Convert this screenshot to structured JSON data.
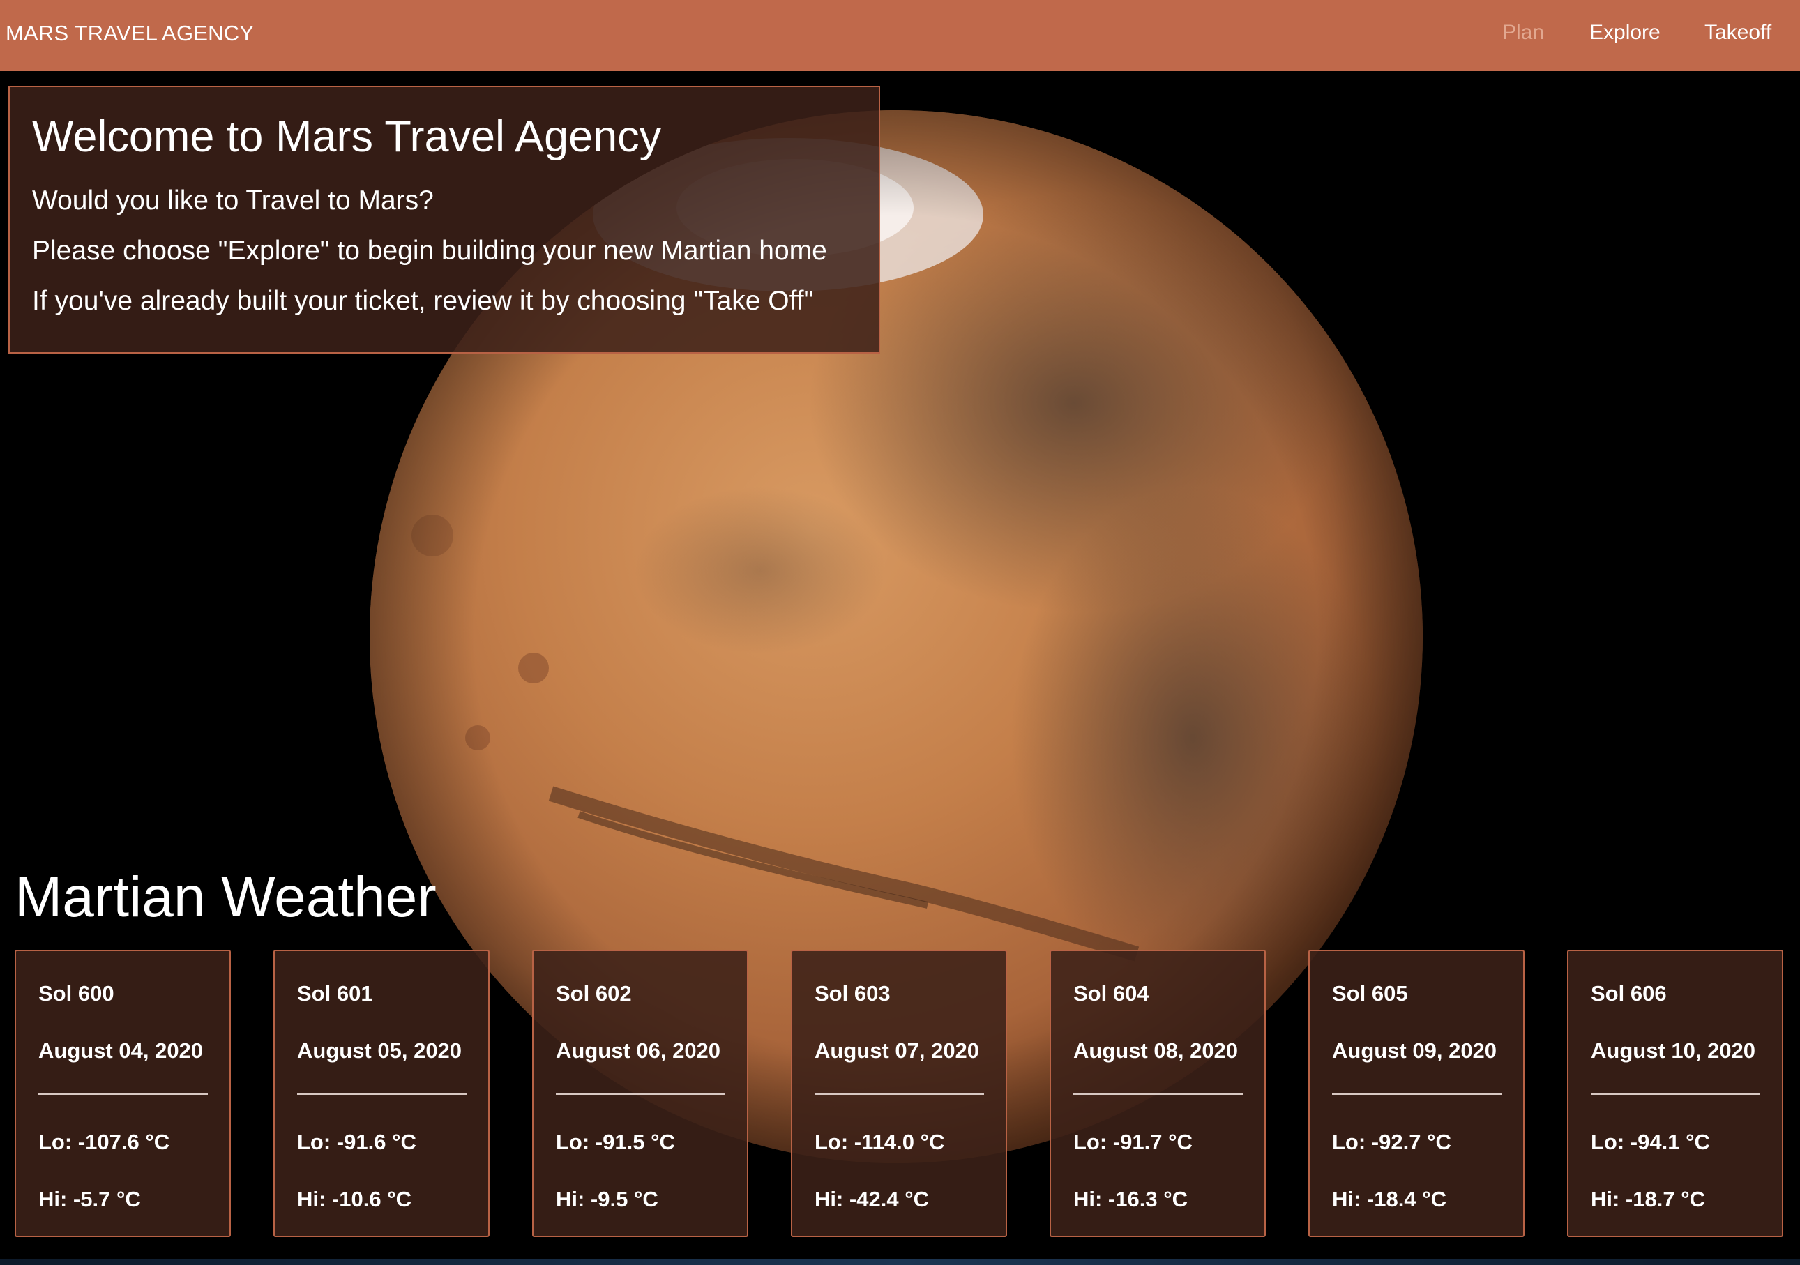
{
  "navbar": {
    "brand": "MARS TRAVEL AGENCY",
    "items": [
      {
        "label": "Plan",
        "state": "active-muted"
      },
      {
        "label": "Explore"
      },
      {
        "label": "Takeoff"
      }
    ]
  },
  "welcome": {
    "title": "Welcome to Mars Travel Agency",
    "line1": "Would you like to Travel to Mars?",
    "line2": "Please choose \"Explore\" to begin building your new Martian home",
    "line3": "If you've already built your ticket, review it by choosing \"Take Off\""
  },
  "weather": {
    "title": "Martian Weather",
    "cards": [
      {
        "sol": "Sol 600",
        "date": "August 04, 2020",
        "lo": "Lo: -107.6 °C",
        "hi": "Hi: -5.7 °C"
      },
      {
        "sol": "Sol 601",
        "date": "August 05, 2020",
        "lo": "Lo: -91.6 °C",
        "hi": "Hi: -10.6 °C"
      },
      {
        "sol": "Sol 602",
        "date": "August 06, 2020",
        "lo": "Lo: -91.5 °C",
        "hi": "Hi: -9.5 °C"
      },
      {
        "sol": "Sol 603",
        "date": "August 07, 2020",
        "lo": "Lo: -114.0 °C",
        "hi": "Hi: -42.4 °C"
      },
      {
        "sol": "Sol 604",
        "date": "August 08, 2020",
        "lo": "Lo: -91.7 °C",
        "hi": "Hi: -16.3 °C"
      },
      {
        "sol": "Sol 605",
        "date": "August 09, 2020",
        "lo": "Lo: -92.7 °C",
        "hi": "Hi: -18.4 °C"
      },
      {
        "sol": "Sol 606",
        "date": "August 10, 2020",
        "lo": "Lo: -94.1 °C",
        "hi": "Hi: -18.7 °C"
      }
    ]
  },
  "colors": {
    "navbar": "#c0694b",
    "panel": "#3c2118",
    "border": "#b86245",
    "background": "#000000"
  },
  "background_image": "mars-globe-image"
}
